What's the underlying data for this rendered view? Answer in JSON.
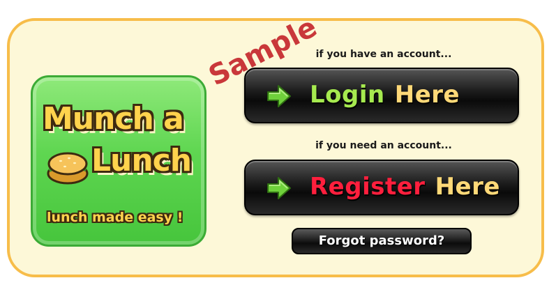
{
  "watermark": {
    "text": "Sample",
    "color": "#c9383a"
  },
  "logo": {
    "line1": "Munch a",
    "line2": "Lunch",
    "tagline": "lunch made easy !",
    "bg_color": "#5fd651",
    "text_color": "#ffd34d"
  },
  "login": {
    "prompt": "if you have an account...",
    "button_word1": "Login",
    "button_word2": "Here",
    "accent": "#a6ea4f"
  },
  "register": {
    "prompt": "if you need an account...",
    "button_word1": "Register",
    "button_word2": "Here",
    "accent": "#ff1f3d"
  },
  "forgot": {
    "label": "Forgot password?"
  },
  "icons": {
    "button_icon": "right-arrow-icon",
    "logo_icon": "sandwich-icon"
  },
  "colors": {
    "panel_bg": "#fdf8d8",
    "panel_border": "#f7bd4a"
  }
}
